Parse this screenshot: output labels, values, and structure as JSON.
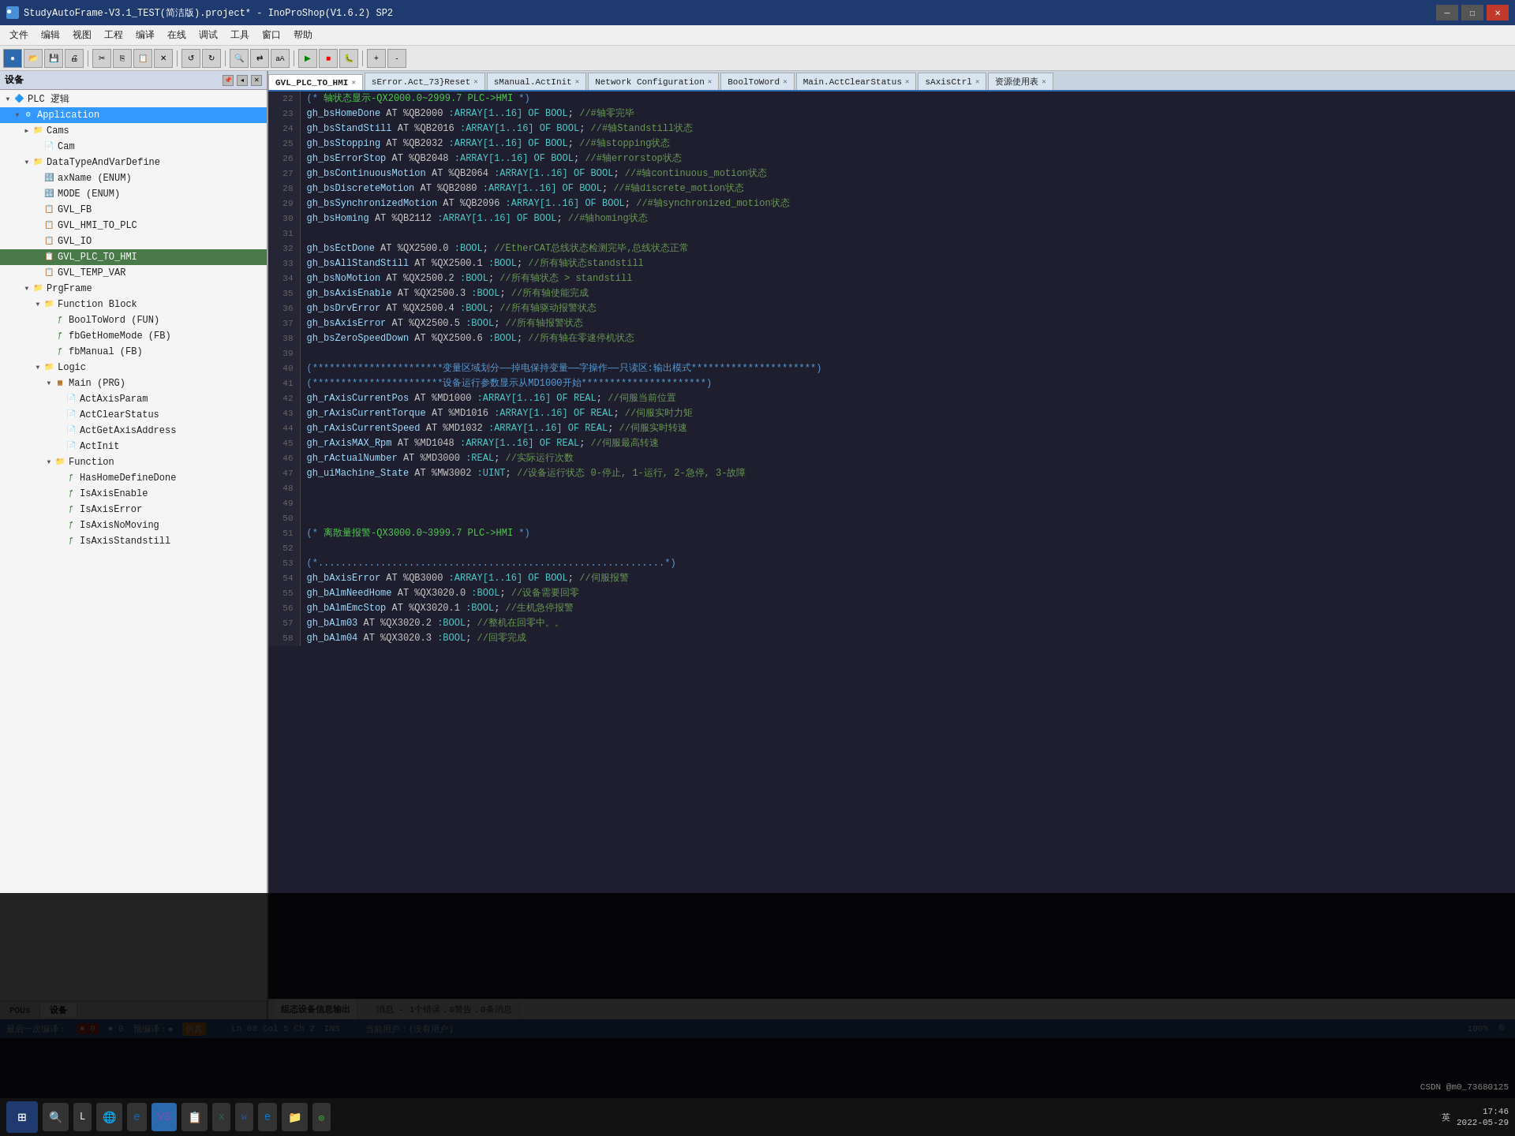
{
  "titlebar": {
    "title": "StudyAutoFrame-V3.1_TEST(简洁版).project* - InoProShop(V1.6.2) SP2",
    "icon": "◈"
  },
  "menubar": {
    "items": [
      "文件",
      "编辑",
      "视图",
      "工程",
      "编译",
      "在线",
      "调试",
      "工具",
      "窗口",
      "帮助"
    ]
  },
  "tabs": [
    {
      "label": "GVL_PLC_TO_HMI",
      "active": false
    },
    {
      "label": "sError.Act_73}Reset",
      "active": false
    },
    {
      "label": "sManual.ActInit",
      "active": false
    },
    {
      "label": "Network Configuration",
      "active": false
    },
    {
      "label": "BoolToWord",
      "active": false
    },
    {
      "label": "Main.ActClearStatus",
      "active": false
    },
    {
      "label": "sAxisCtrl",
      "active": false
    },
    {
      "label": "资源使用表",
      "active": false
    }
  ],
  "left_panel": {
    "title": "设备",
    "tree": [
      {
        "level": 0,
        "label": "PLC 逻辑",
        "type": "plc",
        "arrow": "▼",
        "expanded": true
      },
      {
        "level": 1,
        "label": "Application",
        "type": "app",
        "arrow": "▼",
        "expanded": true
      },
      {
        "level": 2,
        "label": "Cams",
        "type": "folder",
        "arrow": "▶",
        "expanded": false
      },
      {
        "level": 3,
        "label": "Cam",
        "type": "cam",
        "arrow": "",
        "expanded": false
      },
      {
        "level": 2,
        "label": "DataTypeAndVarDefine",
        "type": "folder",
        "arrow": "▼",
        "expanded": true
      },
      {
        "level": 3,
        "label": "axName (ENUM)",
        "type": "enum",
        "arrow": "",
        "expanded": false
      },
      {
        "level": 3,
        "label": "MODE (ENUM)",
        "type": "enum",
        "arrow": "",
        "expanded": false
      },
      {
        "level": 3,
        "label": "GVL_FB",
        "type": "gvl",
        "arrow": "",
        "expanded": false
      },
      {
        "level": 3,
        "label": "GVL_HMI_TO_PLC",
        "type": "gvl",
        "arrow": "",
        "expanded": false
      },
      {
        "level": 3,
        "label": "GVL_IO",
        "type": "gvl",
        "arrow": "",
        "expanded": false
      },
      {
        "level": 3,
        "label": "GVL_PLC_TO_HMI",
        "type": "gvl",
        "arrow": "",
        "expanded": false,
        "selected": true
      },
      {
        "level": 3,
        "label": "GVL_TEMP_VAR",
        "type": "gvl",
        "arrow": "",
        "expanded": false
      },
      {
        "level": 2,
        "label": "PrgFrame",
        "type": "folder",
        "arrow": "▼",
        "expanded": true
      },
      {
        "level": 3,
        "label": "Function Block",
        "type": "folder",
        "arrow": "▼",
        "expanded": true
      },
      {
        "level": 4,
        "label": "BoolToWord (FUN)",
        "type": "func",
        "arrow": "",
        "expanded": false
      },
      {
        "level": 4,
        "label": "fbGetHomeMode (FB)",
        "type": "func",
        "arrow": "",
        "expanded": false
      },
      {
        "level": 4,
        "label": "fbManual (FB)",
        "type": "func",
        "arrow": "",
        "expanded": false
      },
      {
        "level": 3,
        "label": "Logic",
        "type": "folder",
        "arrow": "▼",
        "expanded": true
      },
      {
        "level": 4,
        "label": "Main (PRG)",
        "type": "prog",
        "arrow": "▼",
        "expanded": true
      },
      {
        "level": 5,
        "label": "ActAxisParam",
        "type": "act",
        "arrow": "",
        "expanded": false
      },
      {
        "level": 5,
        "label": "ActClearStatus",
        "type": "act",
        "arrow": "",
        "expanded": false
      },
      {
        "level": 5,
        "label": "ActGetAxisAddress",
        "type": "act",
        "arrow": "",
        "expanded": false
      },
      {
        "level": 5,
        "label": "ActInit",
        "type": "act",
        "arrow": "",
        "expanded": false
      },
      {
        "level": 4,
        "label": "Function",
        "type": "folder",
        "arrow": "▼",
        "expanded": true
      },
      {
        "level": 5,
        "label": "HasHomeDefineDone",
        "type": "func",
        "arrow": "",
        "expanded": false
      },
      {
        "level": 5,
        "label": "IsAxisEnable",
        "type": "func",
        "arrow": "",
        "expanded": false
      },
      {
        "level": 5,
        "label": "IsAxisError",
        "type": "func",
        "arrow": "",
        "expanded": false
      },
      {
        "level": 5,
        "label": "IsAxisNoMoving",
        "type": "func",
        "arrow": "",
        "expanded": false
      },
      {
        "level": 5,
        "label": "IsAxisStandstill",
        "type": "func",
        "arrow": "",
        "expanded": false
      }
    ]
  },
  "code_lines": [
    {
      "num": 22,
      "content": "(* 轴状态显示-QX2000.0~2999.7 PLC->HMI *)",
      "type": "comment"
    },
    {
      "num": 23,
      "content": "gh_bsHomeDone        AT %QB2000      :ARRAY[1..16] OF BOOL;  //#轴零完毕",
      "type": "code"
    },
    {
      "num": 24,
      "content": "gh_bsStandStill      AT %QB2016      :ARRAY[1..16] OF BOOL;  //#轴Standstill状态",
      "type": "code"
    },
    {
      "num": 25,
      "content": "gh_bsStopping        AT %QB2032      :ARRAY[1..16] OF BOOL;  //#轴stopping状态",
      "type": "code"
    },
    {
      "num": 26,
      "content": "gh_bsErrorStop       AT %QB2048      :ARRAY[1..16] OF BOOL;  //#轴errorstop状态",
      "type": "code"
    },
    {
      "num": 27,
      "content": "gh_bsContinuousMotion AT %QB2064     :ARRAY[1..16] OF BOOL;  //#轴continuous_motion状态",
      "type": "code"
    },
    {
      "num": 28,
      "content": "gh_bsDiscreteMotion  AT %QB2080      :ARRAY[1..16] OF BOOL;  //#轴discrete_motion状态",
      "type": "code"
    },
    {
      "num": 29,
      "content": "gh_bsSynchronizedMotion AT %QB2096   :ARRAY[1..16] OF BOOL;  //#轴synchronized_motion状态",
      "type": "code"
    },
    {
      "num": 30,
      "content": "gh_bsHoming          AT %QB2112      :ARRAY[1..16] OF BOOL;  //#轴homing状态",
      "type": "code"
    },
    {
      "num": 31,
      "content": "",
      "type": "empty"
    },
    {
      "num": 32,
      "content": "gh_bsEctDone         AT %QX2500.0    :BOOL;      //EtherCAT总线状态检测完毕,总线状态正常",
      "type": "code"
    },
    {
      "num": 33,
      "content": "gh_bsAllStandStill   AT %QX2500.1    :BOOL;      //所有轴状态standstill",
      "type": "code"
    },
    {
      "num": 34,
      "content": "gh_bsNoMotion        AT %QX2500.2    :BOOL;      //所有轴状态 > standstill",
      "type": "code"
    },
    {
      "num": 35,
      "content": "gh_bsAxisEnable      AT %QX2500.3    :BOOL;      //所有轴使能完成",
      "type": "code"
    },
    {
      "num": 36,
      "content": "gh_bsDrvError        AT %QX2500.4    :BOOL;      //所有轴驱动报警状态",
      "type": "code"
    },
    {
      "num": 37,
      "content": "gh_bsAxisError       AT %QX2500.5    :BOOL;      //所有轴报警状态",
      "type": "code"
    },
    {
      "num": 38,
      "content": "gh_bsZeroSpeedDown   AT %QX2500.6    :BOOL;      //所有轴在零速停机状态",
      "type": "code"
    },
    {
      "num": 39,
      "content": "",
      "type": "empty"
    },
    {
      "num": 40,
      "content": "(***********************变量区域划分——掉电保持变量——字操作——只读区:输出模式**********************)",
      "type": "comment2"
    },
    {
      "num": 41,
      "content": "(***********************设备运行参数显示从MD1000开始**********************)",
      "type": "comment2"
    },
    {
      "num": 42,
      "content": "gh_rAxisCurrentPos   AT %MD1000      :ARRAY[1..16] OF REAL;  //伺服当前位置",
      "type": "code"
    },
    {
      "num": 43,
      "content": "gh_rAxisCurrentTorque AT %MD1016     :ARRAY[1..16] OF REAL;  //伺服实时力矩",
      "type": "code"
    },
    {
      "num": 44,
      "content": "gh_rAxisCurrentSpeed AT %MD1032      :ARRAY[1..16] OF REAL;  //伺服实时转速",
      "type": "code"
    },
    {
      "num": 45,
      "content": "gh_rAxisMAX_Rpm      AT %MD1048      :ARRAY[1..16] OF REAL;  //伺服最高转速",
      "type": "code"
    },
    {
      "num": 46,
      "content": "gh_rActualNumber     AT %MD3000      :REAL;  //实际运行次数",
      "type": "code"
    },
    {
      "num": 47,
      "content": "gh_uiMachine_State   AT %MW3002      :UINT;  //设备运行状态 0-停止, 1-运行, 2-急停, 3-故障",
      "type": "code"
    },
    {
      "num": 48,
      "content": "",
      "type": "empty"
    },
    {
      "num": 49,
      "content": "",
      "type": "empty"
    },
    {
      "num": 50,
      "content": "",
      "type": "empty"
    },
    {
      "num": 51,
      "content": "(* 离散量报警-QX3000.0~3999.7 PLC->HMI  *)",
      "type": "comment"
    },
    {
      "num": 52,
      "content": "",
      "type": "empty"
    },
    {
      "num": 53,
      "content": "(*.............................................................*)",
      "type": "comment_dots"
    },
    {
      "num": 54,
      "content": "gh_bAxisError        AT %QB3000      :ARRAY[1..16] OF BOOL;  //伺服报警",
      "type": "code"
    },
    {
      "num": 55,
      "content": "gh_bAlmNeedHome      AT %QX3020.0    :BOOL;  //设备需要回零",
      "type": "code"
    },
    {
      "num": 56,
      "content": "gh_bAlmEmcStop       AT %QX3020.1    :BOOL;  //生机急停报警",
      "type": "code"
    },
    {
      "num": 57,
      "content": "gh_bAlm03            AT %QX3020.2    :BOOL;  //整机在回零中。。",
      "type": "code"
    },
    {
      "num": 58,
      "content": "gh_bAlm04            AT %QX3020.3    :BOOL;  //回零完成",
      "type": "code"
    }
  ],
  "bottom_tabs": [
    {
      "label": "POUs",
      "active": false
    },
    {
      "label": "设备",
      "active": true
    }
  ],
  "message_bar": {
    "tabs": [
      {
        "label": "组态设备信息输出",
        "active": true
      },
      {
        "label": "消息 - 1个错误，0警告，0条消息",
        "active": false
      }
    ]
  },
  "status_bar": {
    "last_compile": "最后一次编译：",
    "errors": "● 0",
    "warnings": "● 0",
    "preview": "预编译：●",
    "mode_label": "仿真",
    "position": "Ln 68  Col 5  Ch 2",
    "insert": "INS",
    "user": "当前用户：(没有用户)",
    "zoom": "100%"
  },
  "taskbar": {
    "time": "17:46",
    "date": "2022-05-29",
    "apps": [
      "⊞",
      "🔍",
      "L",
      "🌐",
      "IE",
      "VS",
      "📋",
      "Excel",
      "W",
      "Edge",
      "📁",
      "◎"
    ]
  },
  "watermark": "CSDN @m0_73680125"
}
